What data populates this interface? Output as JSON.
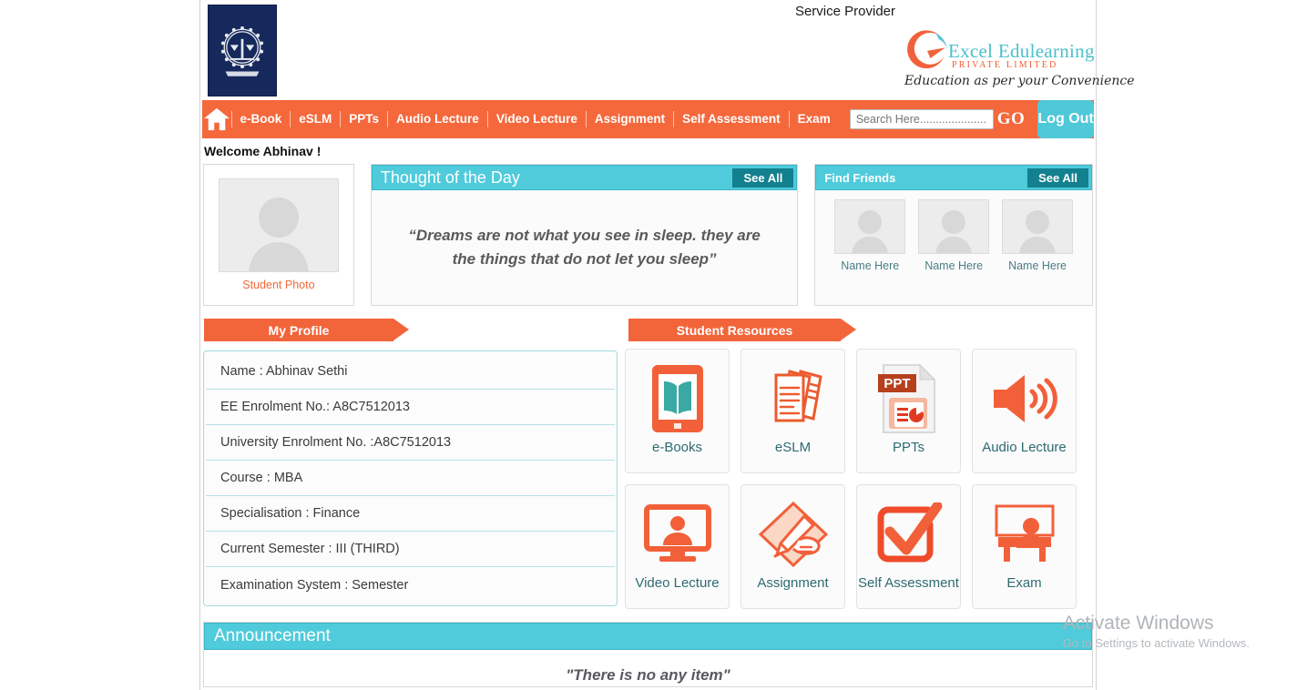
{
  "header": {
    "service_provider": "Service Provider",
    "brand_name": "Excel Edulearning",
    "brand_sub": "PRIVATE LIMITED",
    "brand_tagline": "Education as per your Convenience",
    "university_logo_alt": "University Emblem"
  },
  "nav": {
    "home_label": "Home",
    "items": [
      {
        "label": "e-Book"
      },
      {
        "label": "eSLM"
      },
      {
        "label": "PPTs"
      },
      {
        "label": "Audio Lecture"
      },
      {
        "label": "Video Lecture"
      },
      {
        "label": "Assignment"
      },
      {
        "label": "Self Assessment"
      },
      {
        "label": "Exam"
      }
    ],
    "search_placeholder": "Search Here.........................",
    "search_value": "",
    "go_label": "GO",
    "logout_label": "Log Out"
  },
  "welcome": "Welcome Abhinav !",
  "student_photo": {
    "caption": "Student Photo"
  },
  "thought": {
    "title": "Thought of the Day",
    "see_all": "See All",
    "quote": "“Dreams are not what you see in sleep. they are the things that do not let you sleep”"
  },
  "friends": {
    "title": "Find Friends",
    "see_all": "See All",
    "list": [
      {
        "name": "Name Here"
      },
      {
        "name": "Name Here"
      },
      {
        "name": "Name Here"
      }
    ]
  },
  "profile": {
    "ribbon": "My Profile",
    "rows": [
      "Name : Abhinav Sethi",
      "EE Enrolment No.: A8C7512013",
      "University Enrolment No. :A8C7512013",
      "Course : MBA",
      "Specialisation : Finance",
      "Current Semester : III (THIRD)",
      "Examination System : Semester"
    ]
  },
  "resources": {
    "ribbon": "Student Resources",
    "tiles": [
      {
        "label": "e-Books",
        "icon": "ebook-icon"
      },
      {
        "label": "eSLM",
        "icon": "documents-icon"
      },
      {
        "label": "PPTs",
        "icon": "ppt-file-icon"
      },
      {
        "label": "Audio Lecture",
        "icon": "speaker-icon"
      },
      {
        "label": "Video Lecture",
        "icon": "monitor-person-icon"
      },
      {
        "label": "Assignment",
        "icon": "hand-pencil-icon"
      },
      {
        "label": "Self Assessment",
        "icon": "checkmark-box-icon"
      },
      {
        "label": "Exam",
        "icon": "exam-desk-icon"
      }
    ]
  },
  "announcement": {
    "title": "Announcement",
    "empty_text": "\"There is no any item\""
  },
  "watermark": {
    "line1": "Activate Windows",
    "line2": "Go to Settings to activate Windows."
  },
  "colors": {
    "orange": "#f2643a",
    "cyan": "#4fcbdb",
    "teal_dark": "#13808f",
    "navy": "#15295c",
    "label_teal": "#2e6a72"
  }
}
